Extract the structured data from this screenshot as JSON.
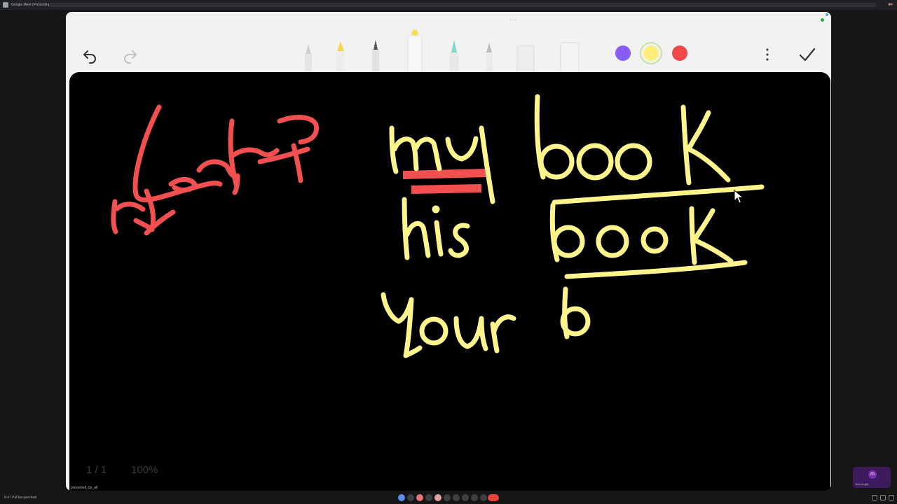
{
  "browser": {
    "tab_title": "Google Meet (Presenting)",
    "tray_badge": "■▾"
  },
  "app": {
    "grabber": "• • •",
    "toolbar": {
      "undo_icon": "undo-arrow-icon",
      "redo_icon": "redo-arrow-icon",
      "tools": [
        "pen-icon",
        "highlighter-icon",
        "fine-pen-icon",
        "marker-icon",
        "brush-icon",
        "pencil-icon",
        "eraser-icon",
        "ruler-icon"
      ],
      "colors": [
        "#8a5cf6",
        "#ffef7a",
        "#f04a4a"
      ],
      "selected_color": "#ffef7a",
      "menu_icon": "more-vertical-icon",
      "done_icon": "check-icon"
    },
    "canvas": {
      "background": "#000000",
      "page_indicator": "1 / 1",
      "zoom": "100%",
      "sharer_label": "presented_by_all",
      "ink": {
        "red": "#f25050",
        "yellow": "#fff58c",
        "arabic_text": "صمم ميكيم",
        "lines": [
          "my book",
          "his book",
          "your b"
        ]
      }
    }
  },
  "taskbar": {
    "time": "8:47 PM",
    "meeting_code": "ksr-jsvt-hwk"
  },
  "self_view": {
    "avatar_letter": "m",
    "name": "You (m.gh)"
  }
}
